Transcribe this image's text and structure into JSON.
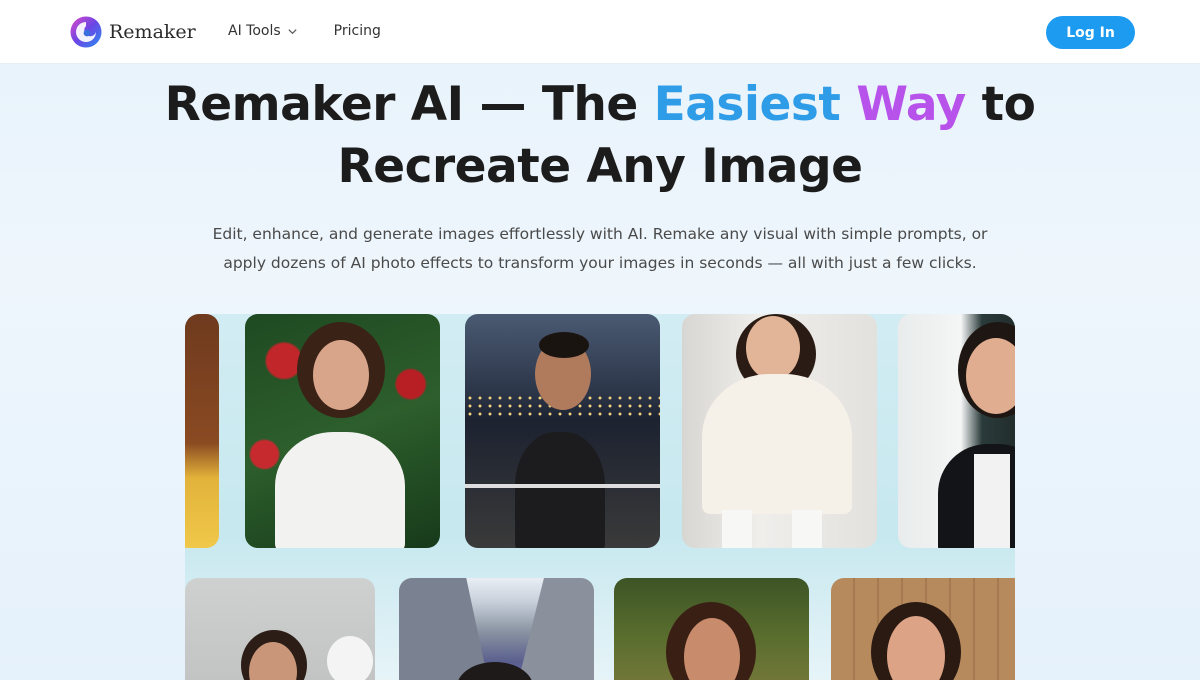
{
  "header": {
    "brand": "Remaker",
    "nav": [
      {
        "label": "AI Tools",
        "has_dropdown": true
      },
      {
        "label": "Pricing",
        "has_dropdown": false
      }
    ],
    "login_label": "Log In"
  },
  "hero": {
    "title_part1": "Remaker AI — The ",
    "title_highlight1": "Easiest",
    "title_highlight2": "Way",
    "title_part2": " to",
    "title_line2": "Recreate Any Image",
    "subtitle_line1": "Edit, enhance, and generate images effortlessly with AI. Remake any visual with simple prompts, or",
    "subtitle_line2": "apply dozens of AI photo effects to transform your images in seconds — all with just a few clicks."
  },
  "colors": {
    "accent_blue": "#1d9bf0",
    "highlight_blue": "#2f9ce8",
    "highlight_purple": "#b753ea",
    "background": "#e7f2fb"
  },
  "icons": [
    "remaker-logo-icon",
    "chevron-down-icon"
  ]
}
